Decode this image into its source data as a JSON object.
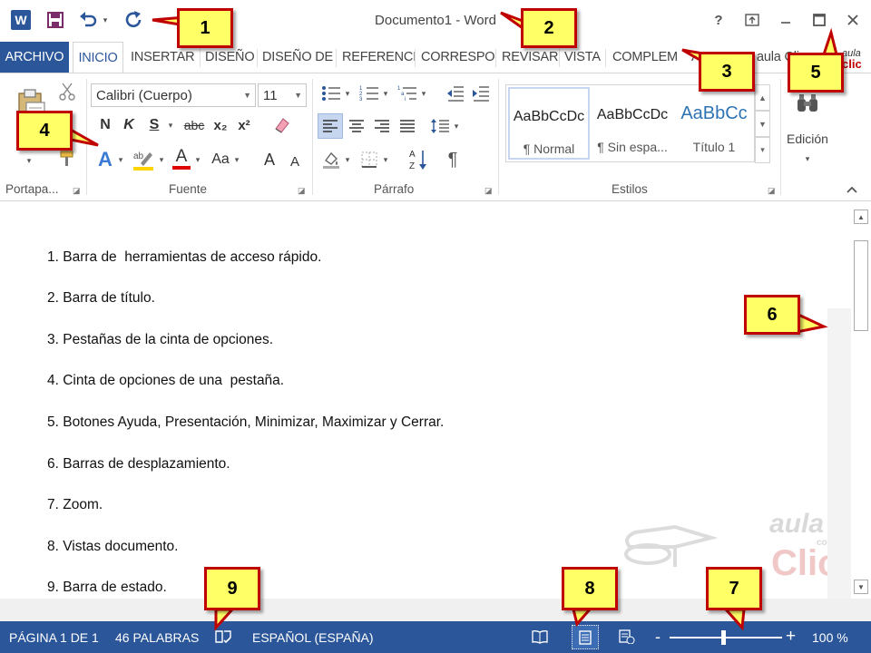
{
  "titlebar": {
    "title": "Documento1 - Word",
    "app_icon_letter": "W",
    "help": "?",
    "ribbon_display": "⧉",
    "minimize": "—",
    "maximize": "☐",
    "close": "✕"
  },
  "tabs": [
    {
      "label": "ARCHIVO"
    },
    {
      "label": "INICIO"
    },
    {
      "label": "INSERTAR"
    },
    {
      "label": "DISEÑO"
    },
    {
      "label": "DISEÑO DE"
    },
    {
      "label": "REFERENCI"
    },
    {
      "label": "CORRESPO"
    },
    {
      "label": "REVISAR"
    },
    {
      "label": "VISTA"
    },
    {
      "label": "COMPLEM"
    },
    {
      "label": "A"
    },
    {
      "label": "aula Cli"
    }
  ],
  "ribbon": {
    "font_name": "Calibri (Cuerpo)",
    "font_size": "11",
    "bold": "N",
    "italic": "K",
    "underline": "S",
    "strike": "abc",
    "subscript": "x₂",
    "superscript": "x²",
    "change_case": "Aa",
    "grow_font": "A",
    "shrink_font": "A",
    "text_effect": "A",
    "font_color": "A",
    "sort": "A↓Z",
    "pilcrow": "¶",
    "edicion": "Edición",
    "groups": {
      "portapapeles": "Portapa...",
      "fuente": "Fuente",
      "parrafo": "Párrafo",
      "estilos": "Estilos"
    },
    "styles": [
      {
        "sample": "AaBbCcDc",
        "name": "¶ Normal"
      },
      {
        "sample": "AaBbCcDc",
        "name": "¶ Sin espa..."
      },
      {
        "sample": "AaBbCc",
        "name": "Título 1"
      }
    ]
  },
  "document": {
    "lines": [
      "1. Barra de  herramientas de acceso rápido.",
      "2. Barra de título.",
      "3. Pestañas de la cinta de opciones.",
      "4. Cinta de opciones de una  pestaña.",
      "5. Botones Ayuda, Presentación, Minimizar, Maximizar y Cerrar.",
      "6. Barras de desplazamiento.",
      "7. Zoom.",
      "8. Vistas documento.",
      "9. Barra de estado."
    ]
  },
  "statusbar": {
    "page": "PÁGINA 1 DE 1",
    "words": "46 PALABRAS",
    "language": "ESPAÑOL (ESPAÑA)",
    "zoom_minus": "-",
    "zoom_plus": "+",
    "zoom_level": "100 %"
  },
  "watermark": {
    "top": "aula",
    "small": "com",
    "bottom": "Clic"
  },
  "callouts": [
    "1",
    "2",
    "3",
    "4",
    "5",
    "6",
    "7",
    "8",
    "9"
  ],
  "colors": {
    "accent": "#2b579a",
    "callout_fill": "#ffff66",
    "callout_border": "#c00000"
  }
}
